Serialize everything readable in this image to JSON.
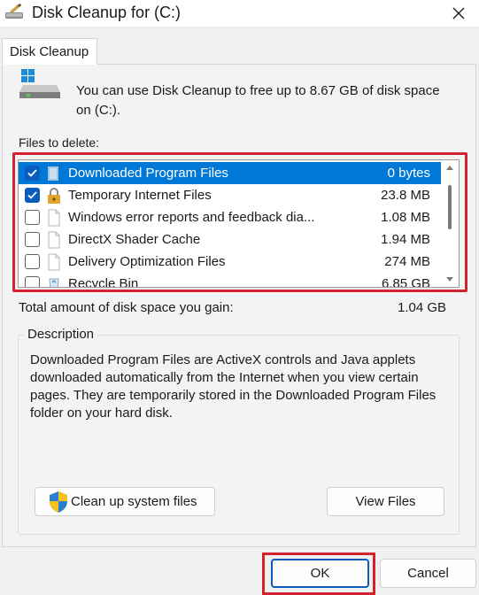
{
  "window": {
    "title": "Disk Cleanup for  (C:)"
  },
  "tab": {
    "label": "Disk Cleanup"
  },
  "intro": {
    "text": "You can use Disk Cleanup to free up to 8.67 GB of disk space on  (C:)."
  },
  "files": {
    "label": "Files to delete:",
    "items": [
      {
        "name": "Downloaded Program Files",
        "size": "0 bytes",
        "checked": true,
        "selected": true,
        "icon": "folder-icon"
      },
      {
        "name": "Temporary Internet Files",
        "size": "23.8 MB",
        "checked": true,
        "selected": false,
        "icon": "lock-icon"
      },
      {
        "name": "Windows error reports and feedback dia...",
        "size": "1.08 MB",
        "checked": false,
        "selected": false,
        "icon": "file-icon"
      },
      {
        "name": "DirectX Shader Cache",
        "size": "1.94 MB",
        "checked": false,
        "selected": false,
        "icon": "file-icon"
      },
      {
        "name": "Delivery Optimization Files",
        "size": "274 MB",
        "checked": false,
        "selected": false,
        "icon": "file-icon"
      },
      {
        "name": "Recycle Bin",
        "size": "6.85 GB",
        "checked": false,
        "selected": false,
        "icon": "recycle-bin-icon"
      }
    ]
  },
  "total": {
    "label": "Total amount of disk space you gain:",
    "value": "1.04 GB"
  },
  "description": {
    "title": "Description",
    "text": "Downloaded Program Files are ActiveX controls and Java applets downloaded automatically from the Internet when you view certain pages. They are temporarily stored in the Downloaded Program Files folder on your hard disk."
  },
  "buttons": {
    "cleanup": "Clean up system files",
    "view_files": "View Files",
    "ok": "OK",
    "cancel": "Cancel"
  },
  "colors": {
    "accent": "#0078d7",
    "highlight_frame": "#d0232f"
  }
}
